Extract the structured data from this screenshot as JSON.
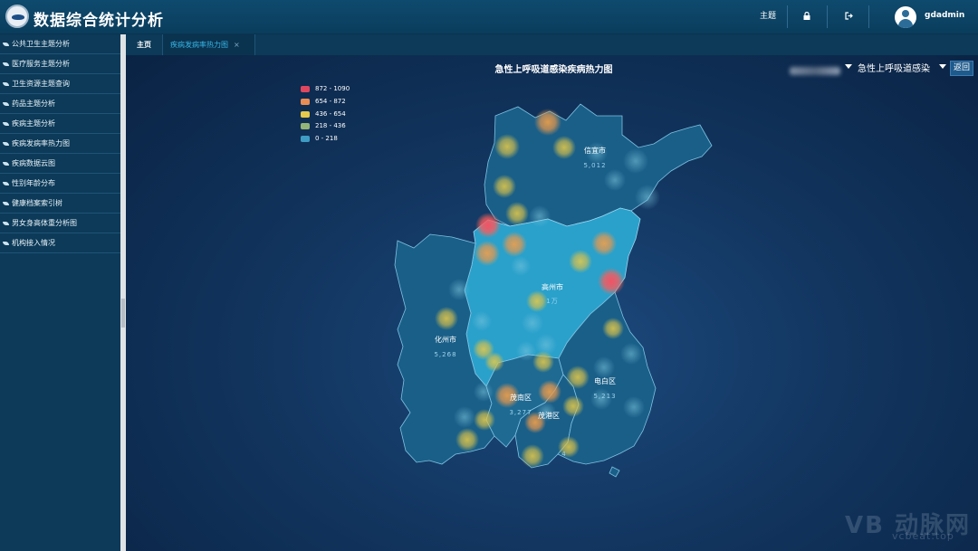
{
  "app": {
    "title": "数据综合统计分析",
    "theme_label": "主题",
    "username": "gdadmin"
  },
  "sidebar": {
    "items": [
      {
        "label": "公共卫生主题分析"
      },
      {
        "label": "医疗服务主题分析"
      },
      {
        "label": "卫生资源主题查询"
      },
      {
        "label": "药品主题分析"
      },
      {
        "label": "疾病主题分析"
      },
      {
        "label": "疾病发病率热力图"
      },
      {
        "label": "疾病数据云图"
      },
      {
        "label": "性别年龄分布"
      },
      {
        "label": "健康档案索引树"
      },
      {
        "label": "男女身高体重分析图"
      },
      {
        "label": "机构接入情况"
      }
    ]
  },
  "tabs": [
    {
      "label": "主页"
    },
    {
      "label": "疾病发病率热力图",
      "close": "×"
    }
  ],
  "map": {
    "title": "急性上呼吸道感染疾病热力图",
    "disease_select": "急性上呼吸道感染",
    "back_label": "返回",
    "legend": [
      {
        "label": "872 - 1090",
        "color": "#e0475e"
      },
      {
        "label": "654 - 872",
        "color": "#e98d55"
      },
      {
        "label": "436 - 654",
        "color": "#e5c94a"
      },
      {
        "label": "218 - 436",
        "color": "#93b477"
      },
      {
        "label": "0 - 218",
        "color": "#3e9cc4"
      }
    ],
    "regions": [
      {
        "name": "信宜市",
        "value": "5,012"
      },
      {
        "name": "高州市",
        "value": "1万"
      },
      {
        "name": "化州市",
        "value": "5,268"
      },
      {
        "name": "电白区",
        "value": "5,213"
      },
      {
        "name": "茂南区",
        "value": "3,277"
      },
      {
        "name": "茂港区",
        "value": ""
      },
      {
        "name": "",
        "value": "4"
      }
    ]
  },
  "watermark": {
    "logo": "VB 动脉网",
    "url": "vcbeat.top"
  }
}
